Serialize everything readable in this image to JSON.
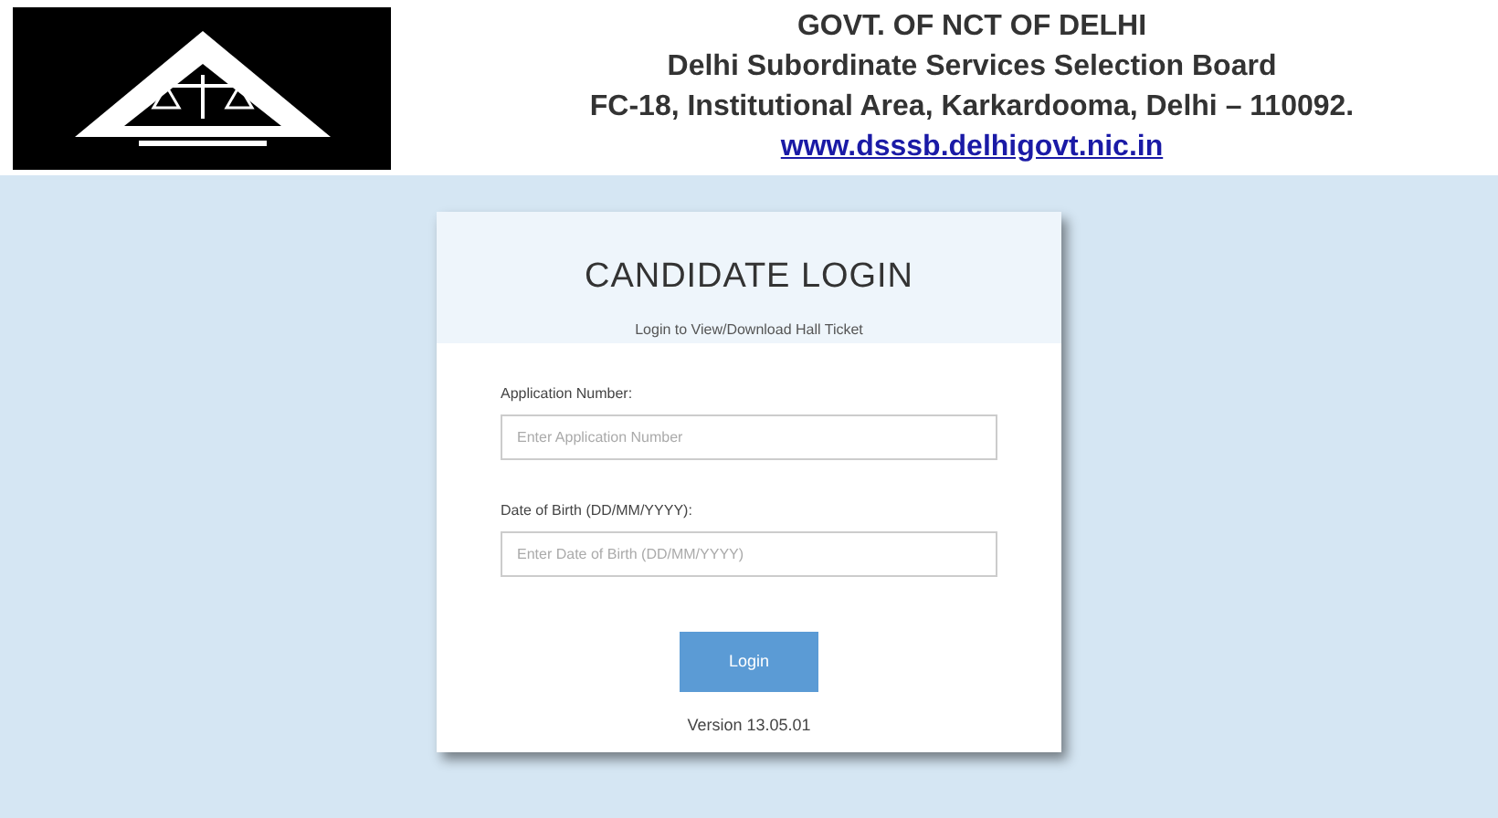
{
  "header": {
    "lines": [
      "GOVT. OF NCT OF DELHI",
      "Delhi Subordinate Services Selection Board",
      "FC-18, Institutional Area, Karkardooma, Delhi – 110092."
    ],
    "link": "www.dsssb.delhigovt.nic.in"
  },
  "login": {
    "title": "CANDIDATE LOGIN",
    "subtitle": "Login to View/Download Hall Ticket",
    "fields": [
      {
        "label": "Application Number:",
        "placeholder": "Enter Application Number"
      },
      {
        "label": "Date of Birth (DD/MM/YYYY):",
        "placeholder": "Enter Date of Birth (DD/MM/YYYY)"
      }
    ],
    "button": "Login",
    "version": "Version 13.05.01"
  }
}
